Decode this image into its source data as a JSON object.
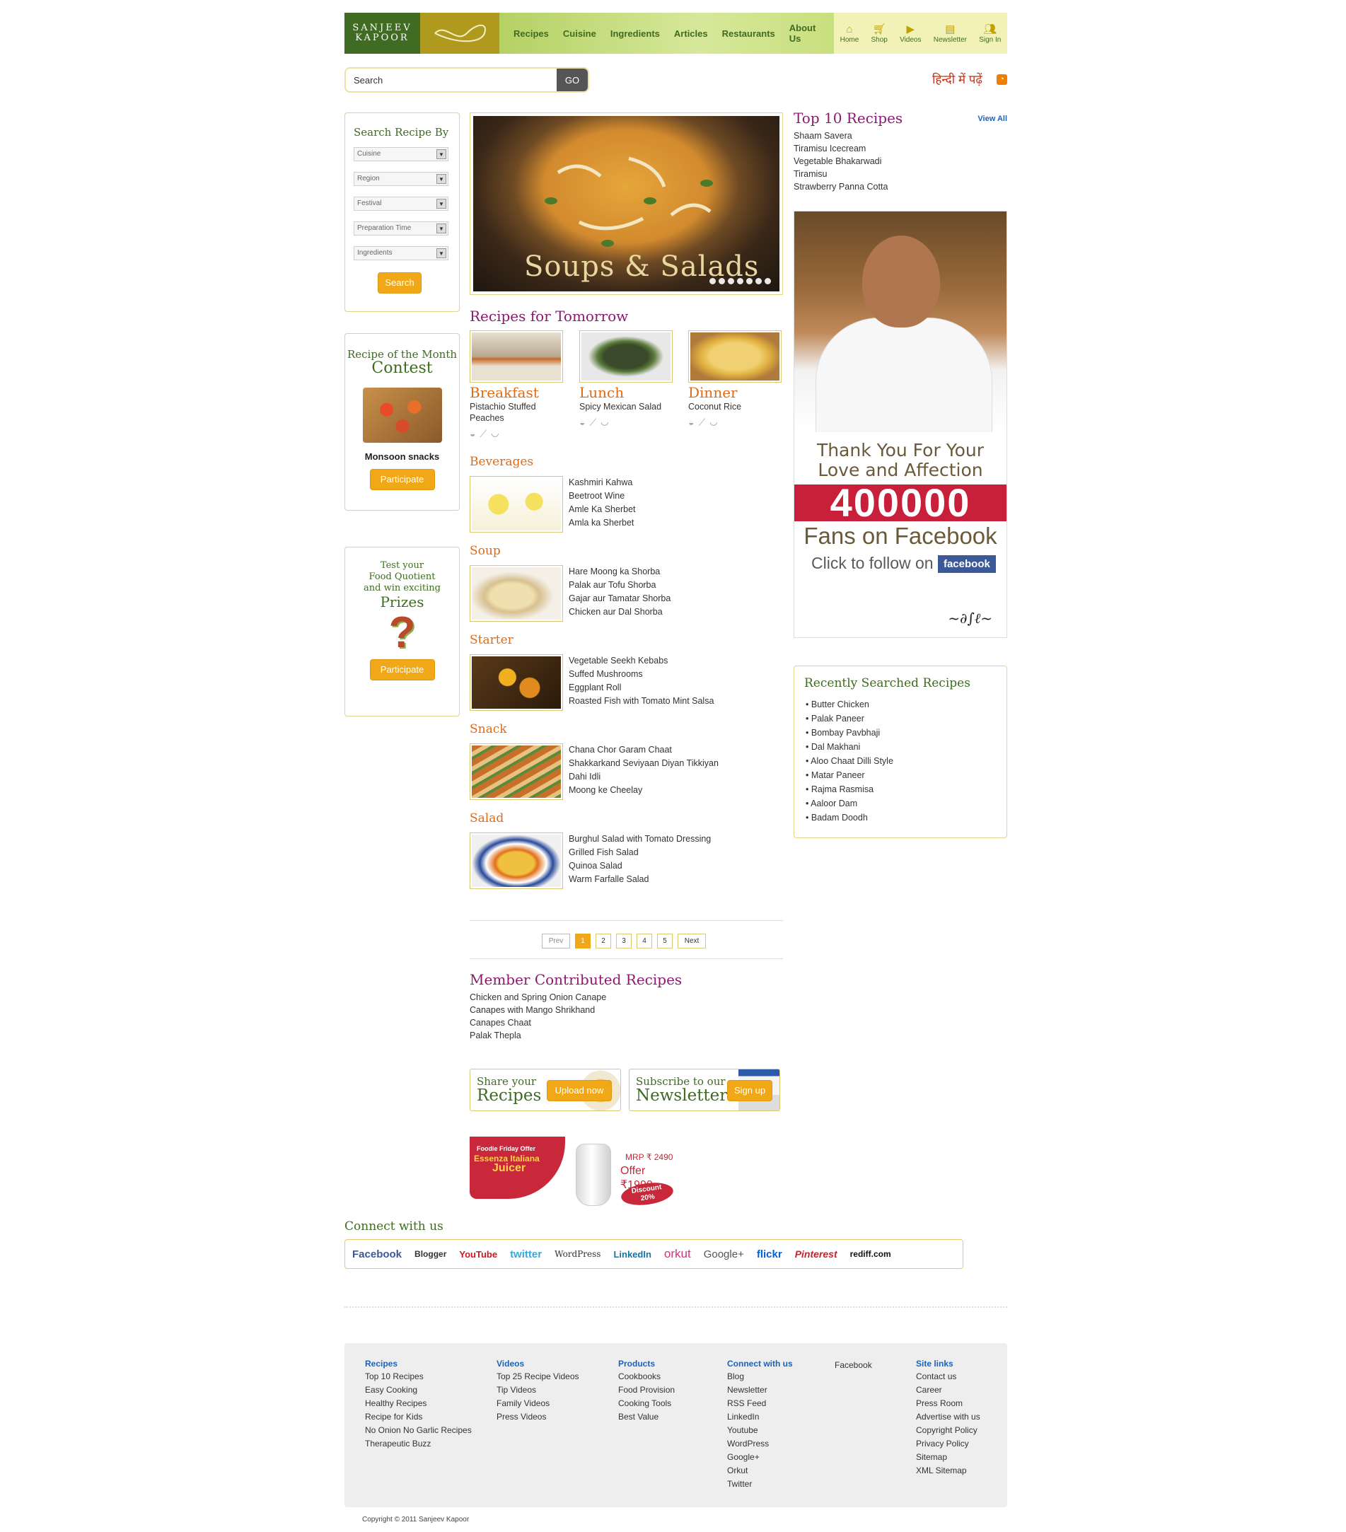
{
  "brand": {
    "line1": "SANJEEV",
    "line2": "KAPOOR"
  },
  "nav": [
    "Recipes",
    "Cuisine",
    "Ingredients",
    "Articles",
    "Restaurants",
    "About Us"
  ],
  "quick_links": [
    {
      "label": "Home",
      "icon": "home-icon"
    },
    {
      "label": "Shop",
      "icon": "cart-icon"
    },
    {
      "label": "Videos",
      "icon": "play-icon"
    },
    {
      "label": "Newsletter",
      "icon": "newsletter-icon"
    },
    {
      "label": "Sign In",
      "icon": "users-icon"
    }
  ],
  "search": {
    "placeholder": "Search",
    "button": "GO"
  },
  "hindi_link": "हिन्दी में पढ़ें",
  "search_recipe": {
    "title": "Search Recipe By",
    "filters": [
      "Cuisine",
      "Region",
      "Festival",
      "Preparation Time",
      "Ingredients"
    ],
    "button": "Search"
  },
  "contest": {
    "line1": "Recipe of the Month",
    "line2": "Contest",
    "caption": "Monsoon snacks",
    "button": "Participate"
  },
  "quiz": {
    "line1": "Test your",
    "line2": "Food Quotient",
    "line3": "and win exciting",
    "line4": "Prizes",
    "button": "Participate"
  },
  "hero": {
    "title": "Soups & Salads",
    "slides": 7
  },
  "tomorrow": {
    "title": "Recipes for Tomorrow",
    "meals": [
      {
        "name": "Breakfast",
        "dish": "Pistachio Stuffed Peaches"
      },
      {
        "name": "Lunch",
        "dish": "Spicy Mexican Salad"
      },
      {
        "name": "Dinner",
        "dish": "Coconut Rice"
      }
    ]
  },
  "categories": [
    {
      "name": "Beverages",
      "items": [
        "Kashmiri Kahwa",
        "Beetroot Wine",
        "Amle Ka Sherbet",
        "Amla ka Sherbet"
      ]
    },
    {
      "name": "Soup",
      "items": [
        "Hare Moong ka Shorba",
        "Palak aur Tofu Shorba",
        "Gajar aur Tamatar Shorba",
        "Chicken aur Dal Shorba"
      ]
    },
    {
      "name": "Starter",
      "items": [
        "Vegetable Seekh Kebabs",
        "Suffed Mushrooms",
        "Eggplant Roll",
        "Roasted Fish with Tomato Mint Salsa"
      ]
    },
    {
      "name": "Snack",
      "items": [
        "Chana Chor Garam Chaat",
        "Shakkarkand Seviyaan Diyan Tikkiyan",
        "Dahi Idli",
        "Moong ke Cheelay"
      ]
    },
    {
      "name": "Salad",
      "items": [
        "Burghul Salad with Tomato Dressing",
        "Grilled Fish Salad",
        "Quinoa Salad",
        "Warm Farfalle Salad"
      ]
    }
  ],
  "pager": {
    "prev": "Prev",
    "pages": [
      "1",
      "2",
      "3",
      "4",
      "5"
    ],
    "next": "Next",
    "current": "1"
  },
  "member": {
    "title": "Member Contributed Recipes",
    "items": [
      "Chicken and Spring Onion Canape",
      "Canapes with Mango Shrikhand",
      "Canapes Chaat",
      "Palak Thepla"
    ]
  },
  "promos": {
    "share": {
      "line1": "Share your",
      "line2": "Recipes",
      "button": "Upload now"
    },
    "subscribe": {
      "line1": "Subscribe to our",
      "line2": "Newsletter",
      "button": "Sign up"
    }
  },
  "juicer": {
    "tag": "Foodie Friday Offer",
    "brand": "Essenza Italiana",
    "product": "Juicer",
    "mrp": "MRP ₹ 2490",
    "offer": "Offer ₹1990",
    "discount_label": "Discount",
    "discount": "20%"
  },
  "top10": {
    "title": "Top 10 Recipes",
    "view_all": "View All",
    "items": [
      "Shaam Savera",
      "Tiramisu Icecream",
      "Vegetable Bhakarwadi",
      "Tiramisu",
      "Strawberry Panna Cotta"
    ]
  },
  "fb_ad": {
    "line1": "Thank You For Your",
    "line2": "Love and Affection",
    "number": "400000",
    "fans": "Fans on Facebook",
    "follow": "Click to follow on",
    "fb": "facebook"
  },
  "recent": {
    "title": "Recently Searched Recipes",
    "items": [
      "Butter Chicken",
      "Palak Paneer",
      "Bombay Pavbhaji",
      "Dal Makhani",
      "Aloo Chaat Dilli Style",
      "Matar Paneer",
      "Rajma Rasmisa",
      "Aaloor Dam",
      "Badam Doodh"
    ]
  },
  "connect": {
    "title": "Connect with us",
    "networks": [
      {
        "label": "Facebook",
        "color": "#3b5998"
      },
      {
        "label": "Blogger",
        "color": "#333333"
      },
      {
        "label": "YouTube",
        "color": "#cc181e"
      },
      {
        "label": "twitter",
        "color": "#33aadd"
      },
      {
        "label": "WordPress",
        "color": "#333333"
      },
      {
        "label": "LinkedIn",
        "color": "#0e76a8"
      },
      {
        "label": "orkut",
        "color": "#d1347f"
      },
      {
        "label": "Google+",
        "color": "#555555"
      },
      {
        "label": "flickr",
        "color": "#0063dc"
      },
      {
        "label": "Pinterest",
        "color": "#cb2027"
      },
      {
        "label": "rediff.com",
        "color": "#111111"
      }
    ]
  },
  "footer": {
    "columns": [
      {
        "title": "Recipes",
        "items": [
          "Top 10 Recipes",
          "Easy Cooking",
          "Healthy Recipes",
          "Recipe for Kids",
          "No Onion No Garlic Recipes",
          "Therapeutic Buzz"
        ]
      },
      {
        "title": "Videos",
        "items": [
          "Top 25 Recipe Videos",
          "Tip Videos",
          "Family Videos",
          "Press Videos"
        ]
      },
      {
        "title": "Products",
        "items": [
          "Cookbooks",
          "Food Provision",
          "Cooking Tools",
          "Best Value"
        ]
      },
      {
        "title": "Connect with us",
        "items": [
          "Blog",
          "Newsletter",
          "RSS Feed",
          "LinkedIn",
          "Youtube",
          "WordPress",
          "Google+",
          "Orkut",
          "Twitter"
        ]
      },
      {
        "title": "",
        "items": [
          "Facebook"
        ]
      },
      {
        "title": "Site links",
        "items": [
          "Contact us",
          "Career",
          "Press Room",
          "Advertise with us",
          "Copyright Policy",
          "Privacy Policy",
          "Sitemap",
          "XML Sitemap"
        ]
      }
    ],
    "copyright": "Copyright © 2011 Sanjeev Kapoor"
  },
  "colors": {
    "brand_green": "#3f6b22",
    "accent_orange": "#f0a818",
    "title_purple": "#8b1a6f",
    "category_orange": "#e06a14",
    "link_blue": "#1a63b8"
  }
}
